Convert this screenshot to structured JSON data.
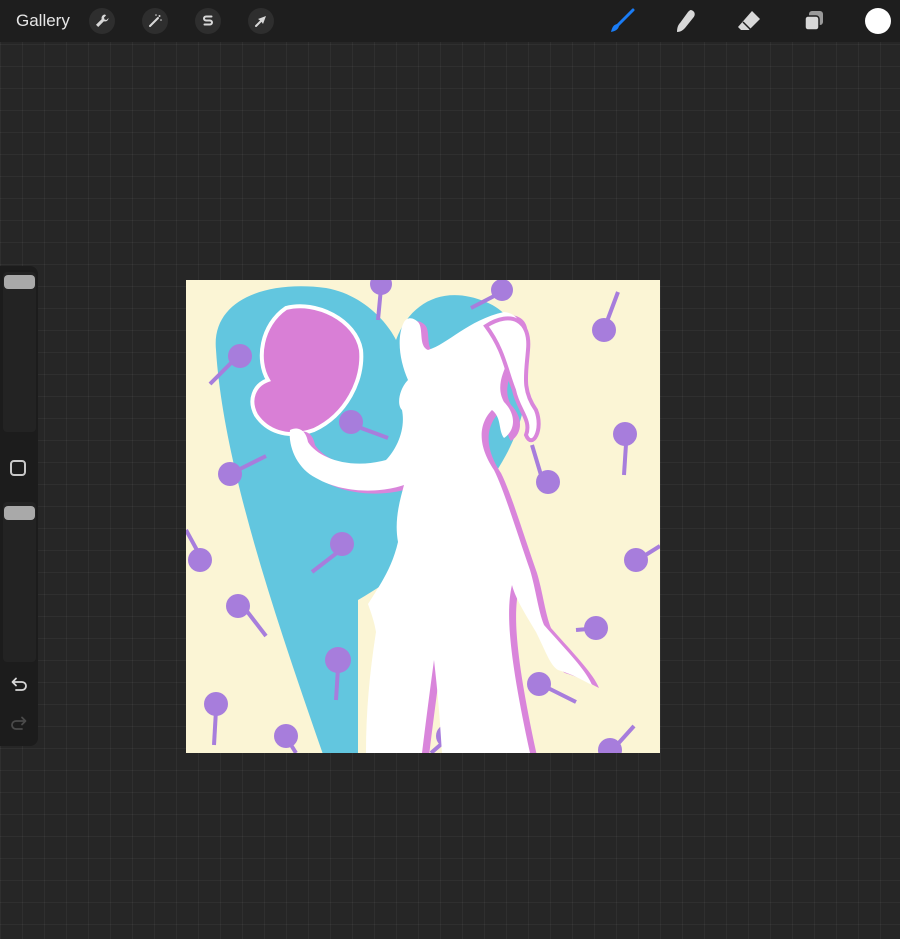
{
  "toolbar": {
    "gallery_label": "Gallery",
    "actions_icon": "wrench-icon",
    "adjustments_icon": "magic-wand-icon",
    "selection_icon": "selection-s-icon",
    "transform_icon": "arrow-cursor-icon",
    "brush_icon": "brush-icon",
    "smudge_icon": "smudge-icon",
    "eraser_icon": "eraser-icon",
    "layers_icon": "layers-icon",
    "active_color": "#ffffff",
    "brush_active_color": "#1a7cf5"
  },
  "sidebar": {
    "size_slider_icon": "brush-size-slider",
    "modify_icon": "square-modify-icon",
    "opacity_slider_icon": "opacity-slider",
    "undo_icon": "undo-icon",
    "redo_icon": "redo-icon"
  },
  "artwork": {
    "background_color": "#fbf5d5",
    "heart_color": "#62c6df",
    "silhouette_color": "#ffffff",
    "outline_color": "#d985db",
    "hair_color": "#d97fd6",
    "lollipop_color": "#a77ddc"
  }
}
